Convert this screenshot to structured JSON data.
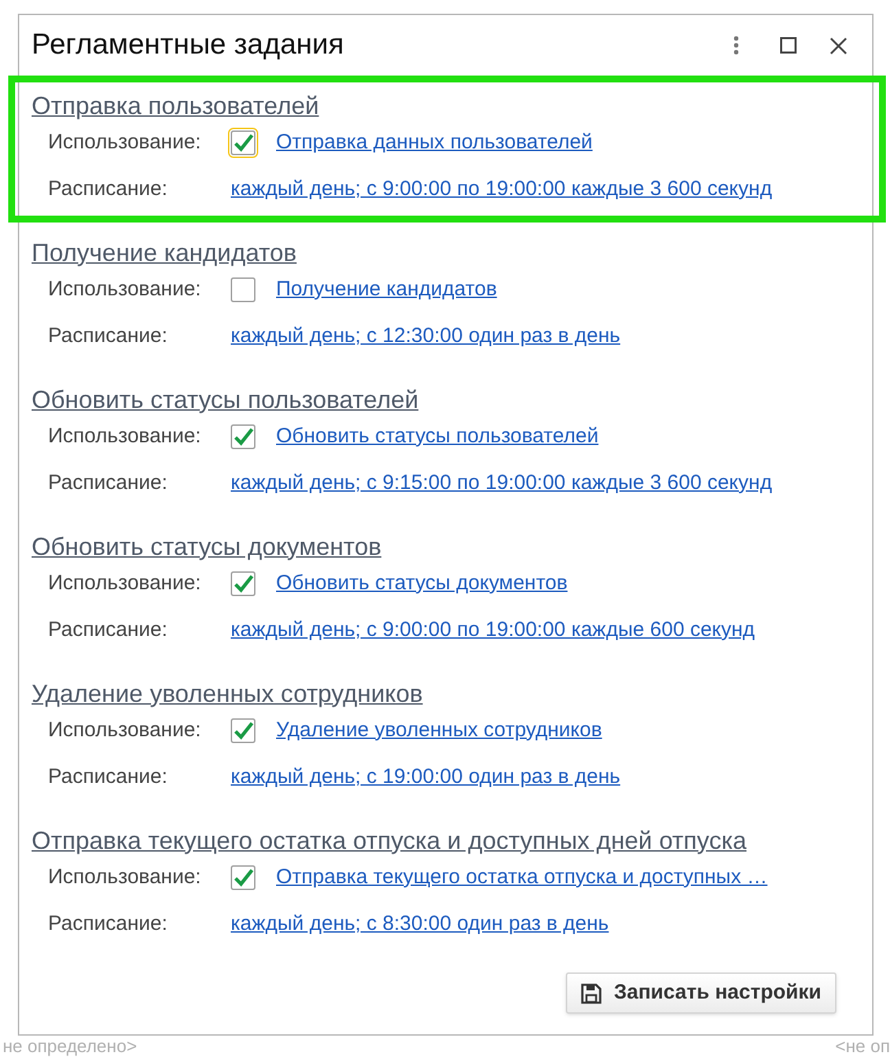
{
  "window": {
    "title": "Регламентные задания"
  },
  "sections": [
    {
      "title": "Отправка пользователей",
      "highlighted": true,
      "usage_label": "Использование:",
      "checked": true,
      "focused": true,
      "usage_link": "Отправка данных пользователей",
      "schedule_label": "Расписание:",
      "schedule": "каждый день; с 9:00:00 по 19:00:00 каждые 3 600 секунд"
    },
    {
      "title": "Получение кандидатов",
      "highlighted": false,
      "usage_label": "Использование:",
      "checked": false,
      "focused": false,
      "usage_link": "Получение кандидатов",
      "schedule_label": "Расписание:",
      "schedule": "каждый день; с 12:30:00 один раз в день"
    },
    {
      "title": "Обновить статусы пользователей",
      "highlighted": false,
      "usage_label": "Использование:",
      "checked": true,
      "focused": false,
      "usage_link": "Обновить статусы пользователей",
      "schedule_label": "Расписание:",
      "schedule": "каждый день; с 9:15:00 по 19:00:00 каждые 3 600 секунд"
    },
    {
      "title": "Обновить статусы документов",
      "highlighted": false,
      "usage_label": "Использование:",
      "checked": true,
      "focused": false,
      "usage_link": "Обновить статусы документов",
      "schedule_label": "Расписание:",
      "schedule": "каждый день; с 9:00:00 по 19:00:00 каждые 600 секунд"
    },
    {
      "title": "Удаление уволенных сотрудников",
      "highlighted": false,
      "usage_label": "Использование:",
      "checked": true,
      "focused": false,
      "usage_link": "Удаление уволенных сотрудников",
      "schedule_label": "Расписание:",
      "schedule": "каждый день; с 19:00:00 один раз в день"
    },
    {
      "title": "Отправка текущего остатка отпуска и доступных дней отпуска",
      "highlighted": false,
      "usage_label": "Использование:",
      "checked": true,
      "focused": false,
      "usage_link": "Отправка текущего остатка отпуска и доступных …",
      "schedule_label": "Расписание:",
      "schedule": "каждый день; с 8:30:00 один раз в день"
    }
  ],
  "save_button": "Записать настройки",
  "background": {
    "cells": [
      "не определено>",
      "<не оп"
    ]
  }
}
